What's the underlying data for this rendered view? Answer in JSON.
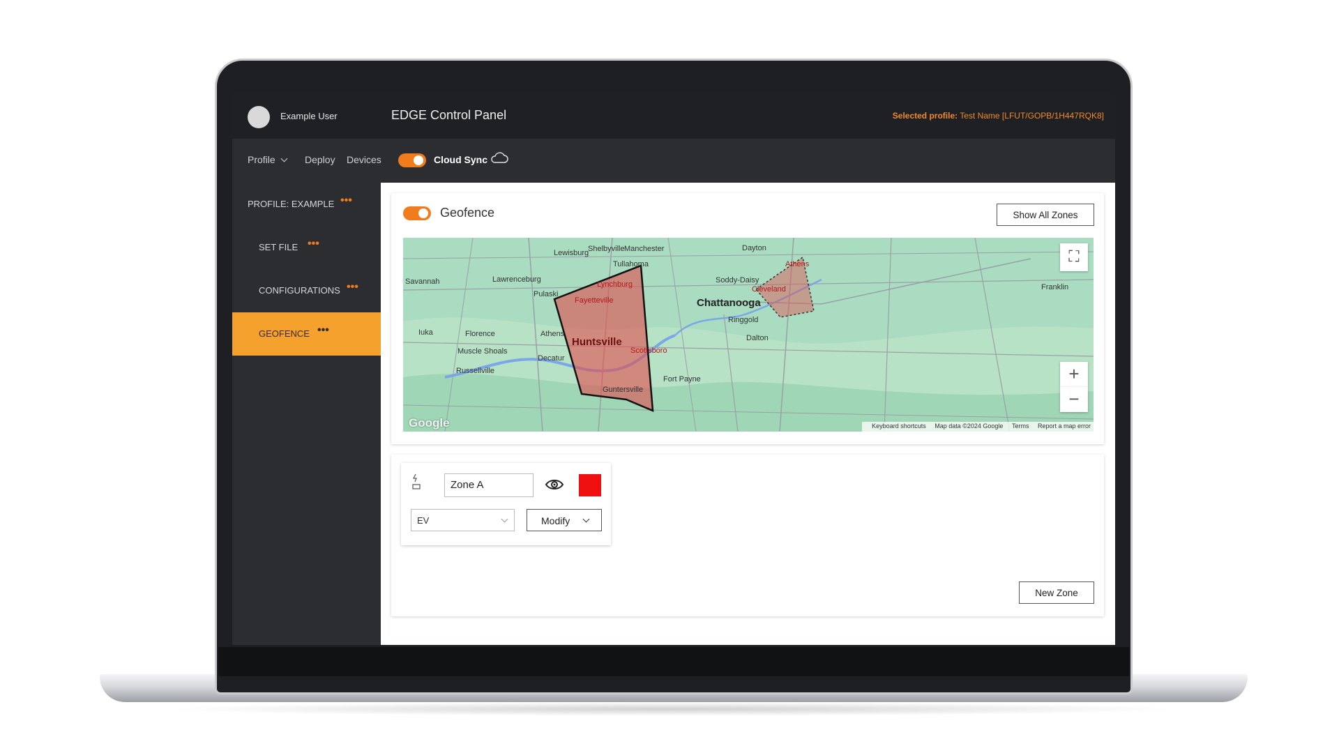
{
  "header": {
    "username": "Example User",
    "app_title": "EDGE Control Panel",
    "selected_profile_label": "Selected profile:",
    "selected_profile_value": "Test Name [LFUT/GOPB/1H447RQK8]"
  },
  "nav": {
    "profile": "Profile",
    "deploy": "Deploy",
    "devices": "Devices",
    "cloud_sync_label": "Cloud Sync",
    "cloud_sync_on": true
  },
  "sidebar": {
    "items": [
      {
        "label": "PROFILE: EXAMPLE",
        "dots": "•••"
      },
      {
        "label": "SET FILE",
        "dots": "•••"
      },
      {
        "label": "CONFIGURATIONS",
        "dots": "•••"
      },
      {
        "label": "GEOFENCE",
        "dots": "•••",
        "active": true
      }
    ]
  },
  "geofence": {
    "title": "Geofence",
    "enabled": true,
    "show_all_zones": "Show All Zones"
  },
  "map": {
    "cities": [
      "Lewisburg",
      "Shelbyville",
      "Manchester",
      "Tullahoma",
      "Dayton",
      "Athens",
      "Savannah",
      "Lawrenceburg",
      "Lynchburg",
      "Soddy-Daisy",
      "Cleveland",
      "Franklin",
      "Pulaski",
      "Fayetteville",
      "Chattanooga",
      "Ringgold",
      "Iuka",
      "Florence",
      "Athens",
      "Huntsville",
      "Scottsboro",
      "Dalton",
      "Muscle Shoals",
      "Decatur",
      "Russellville",
      "Fort Payne",
      "Guntersville"
    ],
    "footer": {
      "shortcuts": "Keyboard shortcuts",
      "data": "Map data ©2024 Google",
      "terms": "Terms",
      "report": "Report a map error"
    },
    "brand": "Google",
    "zoom_in": "+",
    "zoom_out": "−"
  },
  "zone": {
    "name": "Zone A",
    "type": "EV",
    "modify": "Modify",
    "color": "#f01010"
  },
  "new_zone": "New Zone",
  "colors": {
    "accent": "#f07c1e",
    "active_sidebar": "#f5a12e",
    "topbar": "#1f2023",
    "zone_fill": "#e05050"
  }
}
